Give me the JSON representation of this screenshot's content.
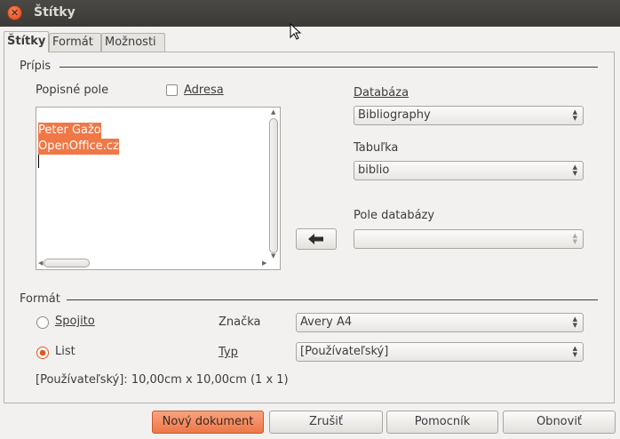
{
  "window": {
    "title": "Štítky"
  },
  "tabs": [
    {
      "label": "Štítky",
      "active": true
    },
    {
      "label": "Formát",
      "active": false
    },
    {
      "label": "Možnosti",
      "active": false
    }
  ],
  "inscription": {
    "section_title": "Prípis",
    "label_field_label": "Popisné pole",
    "address_label": "Adresa",
    "address_checked": false,
    "text_lines": [
      "Peter Gažo",
      "OpenOffice.cz"
    ],
    "database_label": "Databáza",
    "database_value": "Bibliography",
    "table_label": "Tabuľka",
    "table_value": "biblio",
    "db_field_label": "Pole databázy",
    "db_field_value": ""
  },
  "format": {
    "section_title": "Formát",
    "continuous_label": "Spojito",
    "sheet_label": "List",
    "selected": "sheet",
    "brand_label": "Značka",
    "brand_value": "Avery A4",
    "type_label": "Typ",
    "type_value": "[Používateľský]",
    "summary": "[Používateľský]: 10,00cm x 10,00cm (1 x 1)"
  },
  "buttons": {
    "new_document": "Nový dokument",
    "cancel": "Zrušiť",
    "help": "Pomocník",
    "reset": "Obnoviť"
  },
  "colors": {
    "accent": "#f07746",
    "titlebar": "#3c3b37"
  }
}
